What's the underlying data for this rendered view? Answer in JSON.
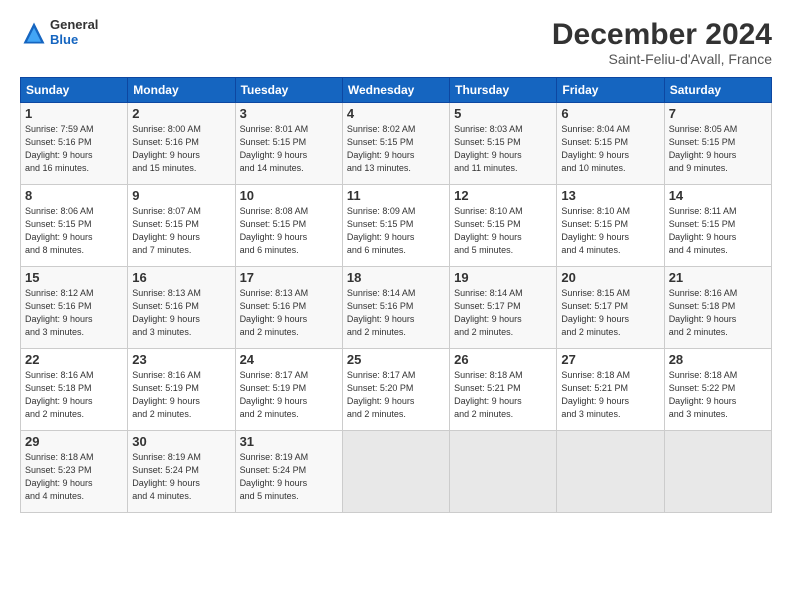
{
  "header": {
    "logo_general": "General",
    "logo_blue": "Blue",
    "month_title": "December 2024",
    "location": "Saint-Feliu-d'Avall, France"
  },
  "days_of_week": [
    "Sunday",
    "Monday",
    "Tuesday",
    "Wednesday",
    "Thursday",
    "Friday",
    "Saturday"
  ],
  "weeks": [
    [
      {
        "day": "1",
        "info": "Sunrise: 7:59 AM\nSunset: 5:16 PM\nDaylight: 9 hours\nand 16 minutes."
      },
      {
        "day": "2",
        "info": "Sunrise: 8:00 AM\nSunset: 5:16 PM\nDaylight: 9 hours\nand 15 minutes."
      },
      {
        "day": "3",
        "info": "Sunrise: 8:01 AM\nSunset: 5:15 PM\nDaylight: 9 hours\nand 14 minutes."
      },
      {
        "day": "4",
        "info": "Sunrise: 8:02 AM\nSunset: 5:15 PM\nDaylight: 9 hours\nand 13 minutes."
      },
      {
        "day": "5",
        "info": "Sunrise: 8:03 AM\nSunset: 5:15 PM\nDaylight: 9 hours\nand 11 minutes."
      },
      {
        "day": "6",
        "info": "Sunrise: 8:04 AM\nSunset: 5:15 PM\nDaylight: 9 hours\nand 10 minutes."
      },
      {
        "day": "7",
        "info": "Sunrise: 8:05 AM\nSunset: 5:15 PM\nDaylight: 9 hours\nand 9 minutes."
      }
    ],
    [
      {
        "day": "8",
        "info": "Sunrise: 8:06 AM\nSunset: 5:15 PM\nDaylight: 9 hours\nand 8 minutes."
      },
      {
        "day": "9",
        "info": "Sunrise: 8:07 AM\nSunset: 5:15 PM\nDaylight: 9 hours\nand 7 minutes."
      },
      {
        "day": "10",
        "info": "Sunrise: 8:08 AM\nSunset: 5:15 PM\nDaylight: 9 hours\nand 6 minutes."
      },
      {
        "day": "11",
        "info": "Sunrise: 8:09 AM\nSunset: 5:15 PM\nDaylight: 9 hours\nand 6 minutes."
      },
      {
        "day": "12",
        "info": "Sunrise: 8:10 AM\nSunset: 5:15 PM\nDaylight: 9 hours\nand 5 minutes."
      },
      {
        "day": "13",
        "info": "Sunrise: 8:10 AM\nSunset: 5:15 PM\nDaylight: 9 hours\nand 4 minutes."
      },
      {
        "day": "14",
        "info": "Sunrise: 8:11 AM\nSunset: 5:15 PM\nDaylight: 9 hours\nand 4 minutes."
      }
    ],
    [
      {
        "day": "15",
        "info": "Sunrise: 8:12 AM\nSunset: 5:16 PM\nDaylight: 9 hours\nand 3 minutes."
      },
      {
        "day": "16",
        "info": "Sunrise: 8:13 AM\nSunset: 5:16 PM\nDaylight: 9 hours\nand 3 minutes."
      },
      {
        "day": "17",
        "info": "Sunrise: 8:13 AM\nSunset: 5:16 PM\nDaylight: 9 hours\nand 2 minutes."
      },
      {
        "day": "18",
        "info": "Sunrise: 8:14 AM\nSunset: 5:16 PM\nDaylight: 9 hours\nand 2 minutes."
      },
      {
        "day": "19",
        "info": "Sunrise: 8:14 AM\nSunset: 5:17 PM\nDaylight: 9 hours\nand 2 minutes."
      },
      {
        "day": "20",
        "info": "Sunrise: 8:15 AM\nSunset: 5:17 PM\nDaylight: 9 hours\nand 2 minutes."
      },
      {
        "day": "21",
        "info": "Sunrise: 8:16 AM\nSunset: 5:18 PM\nDaylight: 9 hours\nand 2 minutes."
      }
    ],
    [
      {
        "day": "22",
        "info": "Sunrise: 8:16 AM\nSunset: 5:18 PM\nDaylight: 9 hours\nand 2 minutes."
      },
      {
        "day": "23",
        "info": "Sunrise: 8:16 AM\nSunset: 5:19 PM\nDaylight: 9 hours\nand 2 minutes."
      },
      {
        "day": "24",
        "info": "Sunrise: 8:17 AM\nSunset: 5:19 PM\nDaylight: 9 hours\nand 2 minutes."
      },
      {
        "day": "25",
        "info": "Sunrise: 8:17 AM\nSunset: 5:20 PM\nDaylight: 9 hours\nand 2 minutes."
      },
      {
        "day": "26",
        "info": "Sunrise: 8:18 AM\nSunset: 5:21 PM\nDaylight: 9 hours\nand 2 minutes."
      },
      {
        "day": "27",
        "info": "Sunrise: 8:18 AM\nSunset: 5:21 PM\nDaylight: 9 hours\nand 3 minutes."
      },
      {
        "day": "28",
        "info": "Sunrise: 8:18 AM\nSunset: 5:22 PM\nDaylight: 9 hours\nand 3 minutes."
      }
    ],
    [
      {
        "day": "29",
        "info": "Sunrise: 8:18 AM\nSunset: 5:23 PM\nDaylight: 9 hours\nand 4 minutes."
      },
      {
        "day": "30",
        "info": "Sunrise: 8:19 AM\nSunset: 5:24 PM\nDaylight: 9 hours\nand 4 minutes."
      },
      {
        "day": "31",
        "info": "Sunrise: 8:19 AM\nSunset: 5:24 PM\nDaylight: 9 hours\nand 5 minutes."
      },
      {
        "day": "",
        "info": ""
      },
      {
        "day": "",
        "info": ""
      },
      {
        "day": "",
        "info": ""
      },
      {
        "day": "",
        "info": ""
      }
    ]
  ]
}
